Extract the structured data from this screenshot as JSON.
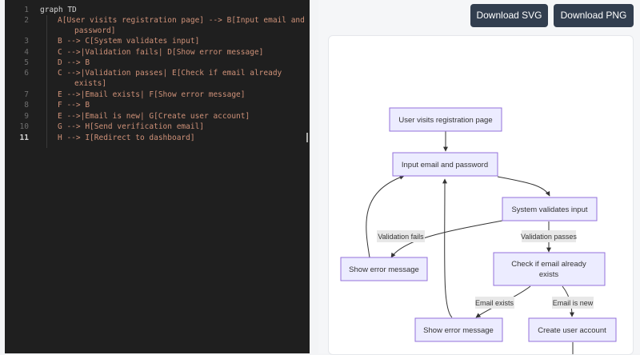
{
  "editor": {
    "lines": [
      {
        "n": "1",
        "text": "graph TD"
      },
      {
        "n": "2",
        "text": "A[User visits registration page] --> B[Input email and"
      },
      {
        "n": "",
        "text": "password]"
      },
      {
        "n": "3",
        "text": "B --> C[System validates input]"
      },
      {
        "n": "4",
        "text": "C -->|Validation fails| D[Show error message]"
      },
      {
        "n": "5",
        "text": "D --> B"
      },
      {
        "n": "6",
        "text": "C -->|Validation passes| E[Check if email already"
      },
      {
        "n": "",
        "text": "exists]"
      },
      {
        "n": "7",
        "text": "E -->|Email exists| F[Show error message]"
      },
      {
        "n": "8",
        "text": "F --> B"
      },
      {
        "n": "9",
        "text": "E -->|Email is new| G[Create user account]"
      },
      {
        "n": "10",
        "text": "G --> H[Send verification email]"
      },
      {
        "n": "11",
        "text": "H --> I[Redirect to dashboard]"
      }
    ]
  },
  "toolbar": {
    "download_svg": "Download SVG",
    "download_png": "Download PNG"
  },
  "diagram": {
    "nodes": {
      "A": "User visits registration page",
      "B": "Input email and password",
      "C": "System validates input",
      "D": "Show error message",
      "E_line1": "Check if email already",
      "E_line2": "exists",
      "F": "Show error message",
      "G": "Create user account"
    },
    "edges": {
      "validation_fails": "Validation fails",
      "validation_passes": "Validation passes",
      "email_exists": "Email exists",
      "email_is_new": "Email is new"
    }
  },
  "colors": {
    "node_fill": "#ECECFF",
    "node_stroke": "#9370DB",
    "edge": "#333333",
    "label_bg": "#E8E8E8",
    "editor_bg": "#1F1F1F",
    "string": "#CE9178",
    "button_bg": "#323E4F"
  }
}
